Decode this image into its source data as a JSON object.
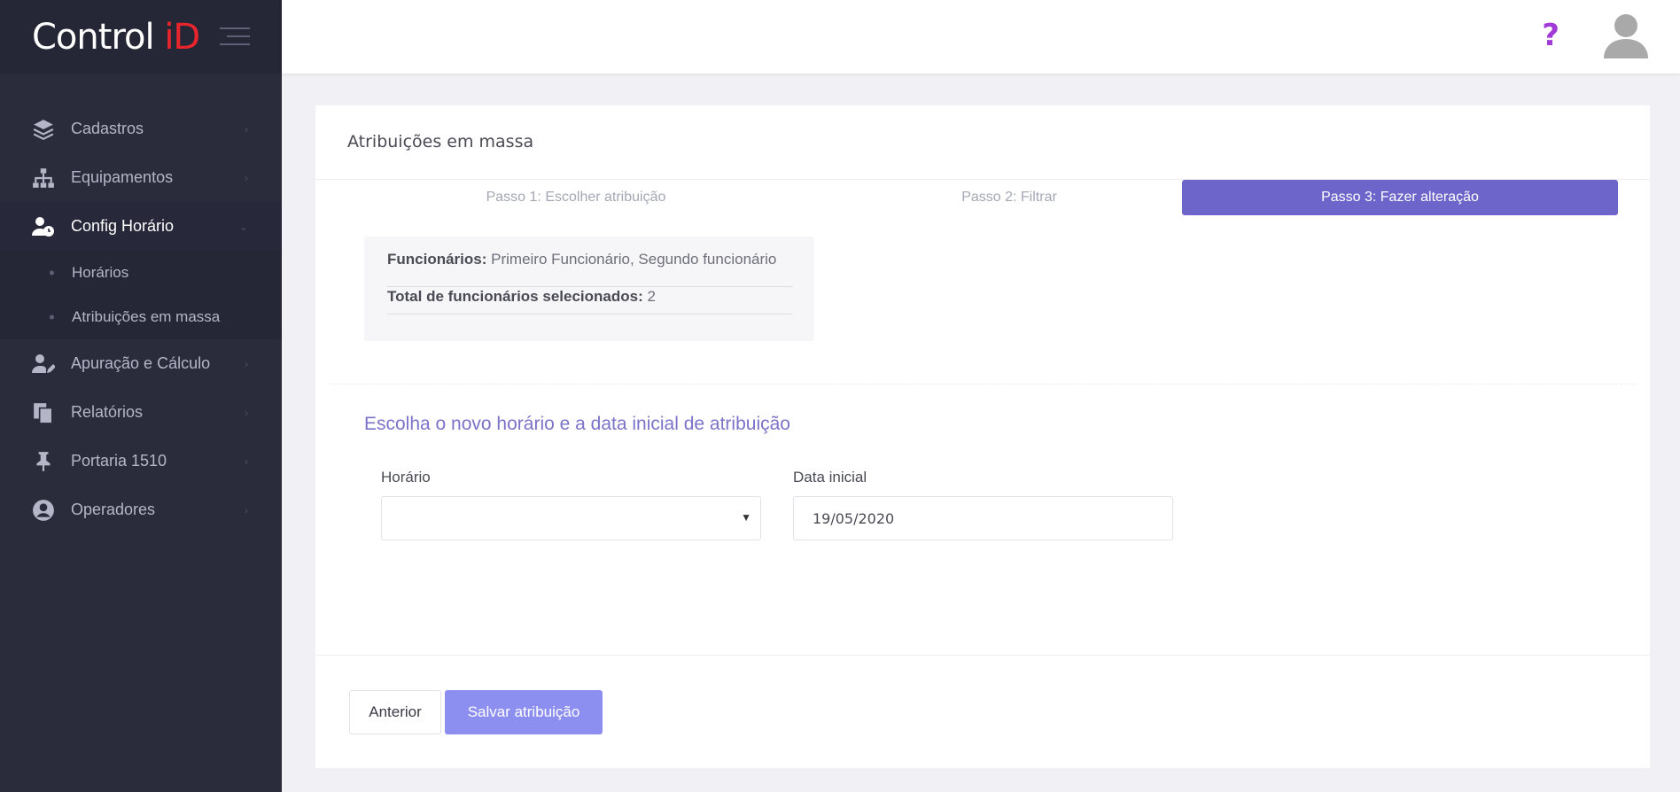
{
  "brand": {
    "text": "Control ",
    "accent": "iD",
    "accent_color": "#e8252d"
  },
  "sidebar": {
    "items": [
      {
        "label": "Cadastros",
        "icon": "layers-icon"
      },
      {
        "label": "Equipamentos",
        "icon": "sitemap-icon"
      },
      {
        "label": "Config Horário",
        "icon": "user-clock-icon",
        "active": true,
        "children": [
          {
            "label": "Horários"
          },
          {
            "label": "Atribuições em massa"
          }
        ]
      },
      {
        "label": "Apuração e Cálculo",
        "icon": "user-edit-icon"
      },
      {
        "label": "Relatórios",
        "icon": "copy-icon"
      },
      {
        "label": "Portaria 1510",
        "icon": "thumbtack-icon"
      },
      {
        "label": "Operadores",
        "icon": "user-circle-icon"
      }
    ]
  },
  "header": {
    "help": "?",
    "help_color": "#a13ad8"
  },
  "page": {
    "title": "Atribuições em massa",
    "steps": [
      {
        "label": "Passo 1: Escolher atribuição"
      },
      {
        "label": "Passo 2: Filtrar"
      },
      {
        "label": "Passo 3: Fazer alteração",
        "active": true
      }
    ],
    "summary": {
      "employees_label": "Funcionários:",
      "employees_value": "Primeiro Funcionário, Segundo funcionário",
      "total_label": "Total de funcionários selecionados:",
      "total_value": "2"
    },
    "section_title": "Escolha o novo horário e a data inicial de atribuição",
    "form": {
      "schedule_label": "Horário",
      "schedule_value": "",
      "start_date_label": "Data inicial",
      "start_date_value": "19/05/2020"
    },
    "buttons": {
      "previous": "Anterior",
      "save": "Salvar atribuição"
    },
    "accent_color": "#6d65c9"
  }
}
